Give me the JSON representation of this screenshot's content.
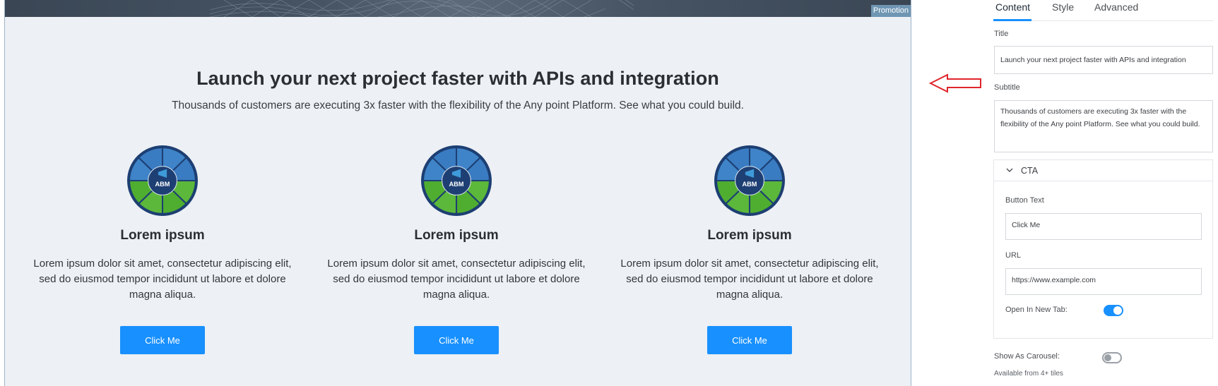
{
  "canvas": {
    "promotion_badge": "Promotion",
    "title": "Launch your next project faster with APIs and integration",
    "subtitle": "Thousands of customers are executing 3x faster with the flexibility of the Any point Platform. See what you could build.",
    "tiles": [
      {
        "image_label": "ABM",
        "title": "Lorem ipsum",
        "text": "Lorem ipsum dolor sit amet, consectetur adipiscing elit, sed do eiusmod tempor incididunt ut labore et dolore magna aliqua.",
        "button": "Click Me"
      },
      {
        "image_label": "ABM",
        "title": "Lorem ipsum",
        "text": "Lorem ipsum dolor sit amet, consectetur adipiscing elit, sed do eiusmod tempor incididunt ut labore et dolore magna aliqua.",
        "button": "Click Me"
      },
      {
        "image_label": "ABM",
        "title": "Lorem ipsum",
        "text": "Lorem ipsum dolor sit amet, consectetur adipiscing elit, sed do eiusmod tempor incididunt ut labore et dolore magna aliqua.",
        "button": "Click Me"
      }
    ]
  },
  "panel": {
    "tabs": [
      {
        "label": "Content",
        "active": true
      },
      {
        "label": "Style",
        "active": false
      },
      {
        "label": "Advanced",
        "active": false
      }
    ],
    "title_label": "Title",
    "title_value": "Launch your next project faster with APIs and integration",
    "subtitle_label": "Subtitle",
    "subtitle_value": "Thousands of customers are executing 3x faster with the flexibility of the Any point Platform. See what you could build.",
    "cta": {
      "section_label": "CTA",
      "button_text_label": "Button Text",
      "button_text_value": "Click Me",
      "url_label": "URL",
      "url_value": "https://www.example.com",
      "new_tab_label": "Open In New Tab:",
      "new_tab_enabled": true
    },
    "carousel_label": "Show As Carousel:",
    "carousel_enabled": false,
    "carousel_hint": "Available from 4+ tiles"
  },
  "colors": {
    "accent": "#1890ff",
    "arrow": "#e0252b",
    "canvas_bg": "#edf0f4"
  },
  "icons": [
    "chevron-down-icon",
    "arrow-left-icon",
    "abm-wheel-icon"
  ]
}
